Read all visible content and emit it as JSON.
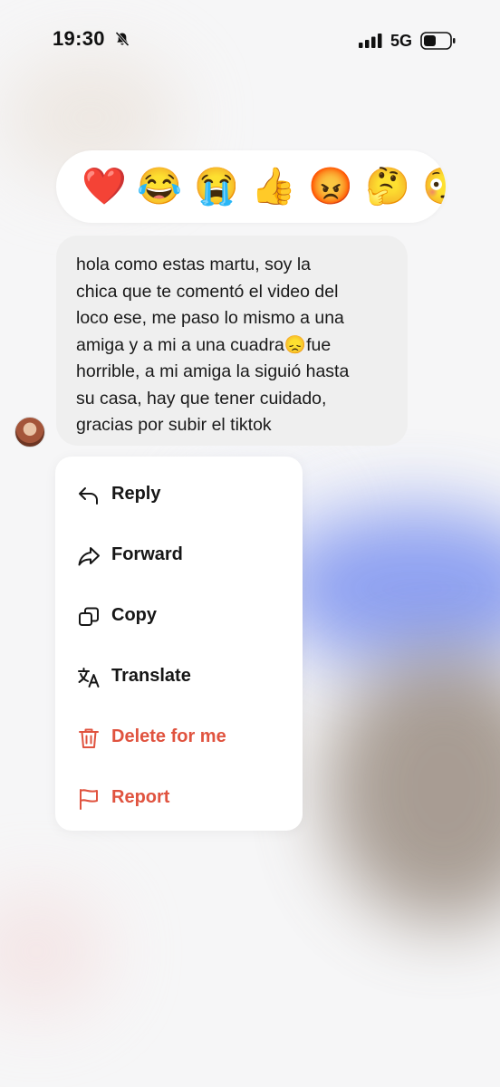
{
  "status_bar": {
    "time": "19:30",
    "network": "5G"
  },
  "reactions": [
    {
      "emoji": "❤️",
      "name": "heart"
    },
    {
      "emoji": "😂",
      "name": "laughing"
    },
    {
      "emoji": "😭",
      "name": "crying"
    },
    {
      "emoji": "👍",
      "name": "thumbs-up"
    },
    {
      "emoji": "😡",
      "name": "angry"
    },
    {
      "emoji": "🤔",
      "name": "thinking"
    },
    {
      "emoji": "😳",
      "name": "flushed"
    }
  ],
  "message": {
    "text": "hola como estas martu, soy la\nchica que te comentó el video del\nloco ese, me paso lo mismo a una\namiga y a mi a una cuadra😞fue\nhorrible, a mi amiga la siguió hasta\nsu casa, hay que tener cuidado,\ngracias por subir el tiktok"
  },
  "menu": {
    "reply": "Reply",
    "forward": "Forward",
    "copy": "Copy",
    "translate": "Translate",
    "delete": "Delete for me",
    "report": "Report"
  },
  "colors": {
    "danger": "#e0533f",
    "bubble": "#efefef"
  }
}
